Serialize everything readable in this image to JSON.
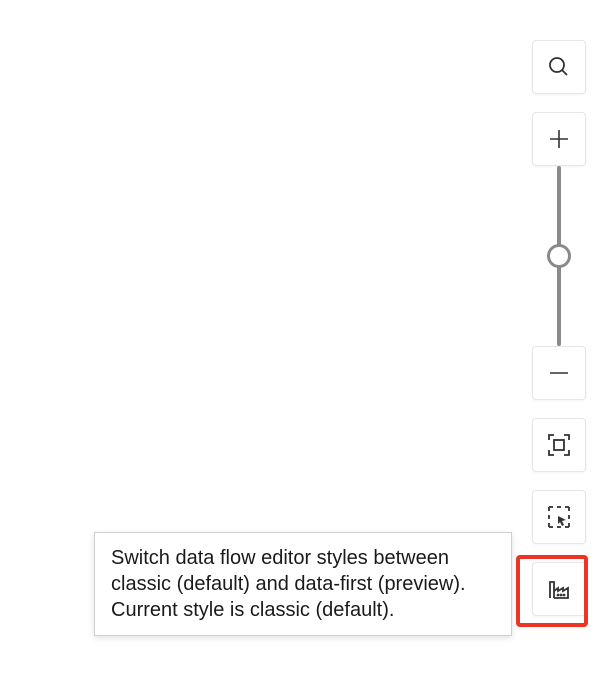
{
  "tooltip": {
    "text": "Switch data flow editor styles between classic (default) and data-first (preview). Current style is classic (default)."
  },
  "toolbar": {
    "search": "search",
    "zoom_in": "zoom-in",
    "zoom_out": "zoom-out",
    "fit_view": "fit-view",
    "box_select": "box-select",
    "style_switch": "style-switch"
  }
}
